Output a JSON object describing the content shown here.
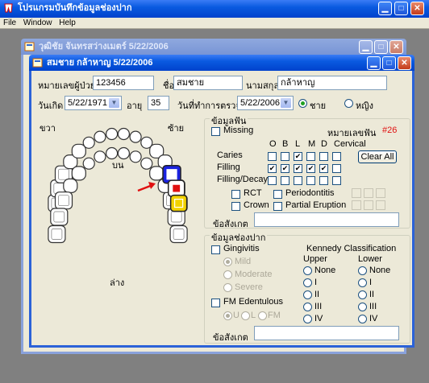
{
  "app": {
    "title": "โปรแกรมบันทึกข้อมูลช่องปาก",
    "menu": [
      "File",
      "Window",
      "Help"
    ]
  },
  "window_back": {
    "title": "วุฒิชัย จันทรสว่างเมตร์ 5/22/2006"
  },
  "window_front": {
    "title": "สมชาย กล้าหาญ 5/22/2006"
  },
  "patient": {
    "hn_label": "หมายเลขผู้ป่วย",
    "hn": "123456",
    "name_label": "ชื่อ",
    "name": "สมชาย",
    "surname_label": "นามสกุล",
    "surname": "กล้าหาญ",
    "dob_label": "วันเกิด",
    "dob": "5/22/1971",
    "age_label": "อายุ",
    "age": "35",
    "exam_label": "วันที่ทำการตรวจ",
    "exam_date": "5/22/2006",
    "male_label": "ชาย",
    "female_label": "หญิง"
  },
  "chart": {
    "right": "ขวา",
    "left": "ซ้าย",
    "upper": "บน",
    "lower": "ล่าง"
  },
  "tooth": {
    "group": "ข้อมูลฟัน",
    "missing": "Missing",
    "number_label": "หมายเลขฟัน",
    "number": "#26",
    "columns": [
      "O",
      "B",
      "L",
      "M",
      "D",
      "Cervical"
    ],
    "rows": [
      {
        "label": "Caries",
        "checks": [
          false,
          false,
          true,
          false,
          false
        ]
      },
      {
        "label": "Filling",
        "checks": [
          true,
          true,
          true,
          true,
          true
        ]
      },
      {
        "label": "Filling/Decay",
        "checks": [
          false,
          false,
          false,
          false,
          false
        ]
      }
    ],
    "clear_all": "Clear All",
    "rct": "RCT",
    "periodontitis": "Periodontitis",
    "crown": "Crown",
    "partial_eruption": "Partial Eruption",
    "note_label": "ข้อสังเกต",
    "note": ""
  },
  "oral": {
    "group": "ข้อมูลช่องปาก",
    "gingivitis": "Gingivitis",
    "mild": "Mild",
    "moderate": "Moderate",
    "severe": "Severe",
    "fm": "FM Edentulous",
    "u": "U",
    "l": "L",
    "fm_short": "FM",
    "kennedy": "Kennedy Classification",
    "upper": "Upper",
    "lower": "Lower",
    "classes": [
      "None",
      "I",
      "II",
      "III",
      "IV"
    ],
    "note_label": "ข้อสังเกต",
    "note": ""
  },
  "colors": {
    "accent": "#2b62d8",
    "filling": "#1a22e0",
    "caries": "#e01010",
    "crown_yellow": "#f2d200",
    "tooth_number": "#e01010"
  }
}
